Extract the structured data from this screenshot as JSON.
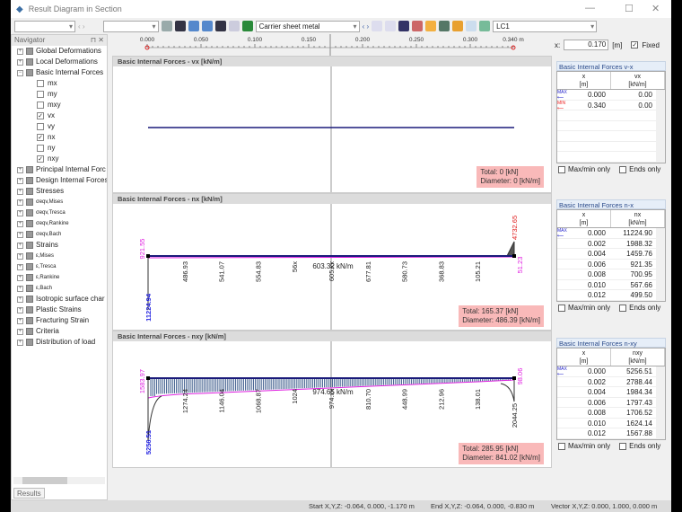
{
  "window": {
    "title": "Result Diagram in Section"
  },
  "toolbar": {
    "member_combo": "Carrier sheet metal",
    "lc_combo": "LC1"
  },
  "navigator": {
    "title": "Navigator",
    "results_tab": "Results",
    "items": [
      {
        "label": "Global Deformations",
        "type": "group"
      },
      {
        "label": "Local Deformations",
        "type": "group"
      },
      {
        "label": "Basic Internal Forces",
        "type": "group-open"
      },
      {
        "label": "mx",
        "type": "check",
        "checked": false
      },
      {
        "label": "my",
        "type": "check",
        "checked": false
      },
      {
        "label": "mxy",
        "type": "check",
        "checked": false
      },
      {
        "label": "vx",
        "type": "check",
        "checked": true
      },
      {
        "label": "vy",
        "type": "check",
        "checked": false
      },
      {
        "label": "nx",
        "type": "check",
        "checked": true
      },
      {
        "label": "ny",
        "type": "check",
        "checked": false
      },
      {
        "label": "nxy",
        "type": "check",
        "checked": true
      },
      {
        "label": "Principal Internal Forc",
        "type": "group"
      },
      {
        "label": "Design Internal Forces",
        "type": "group"
      },
      {
        "label": "Stresses",
        "type": "group"
      },
      {
        "label": "σeqv,Mises",
        "type": "group-small"
      },
      {
        "label": "σeqv,Tresca",
        "type": "group-small"
      },
      {
        "label": "σeqv,Rankine",
        "type": "group-small"
      },
      {
        "label": "σeqv,Bach",
        "type": "group-small"
      },
      {
        "label": "Strains",
        "type": "group"
      },
      {
        "label": "ε,Mises",
        "type": "group-small"
      },
      {
        "label": "ε,Tresca",
        "type": "group-small"
      },
      {
        "label": "ε,Rankine",
        "type": "group-small"
      },
      {
        "label": "ε,Bach",
        "type": "group-small"
      },
      {
        "label": "Isotropic surface char",
        "type": "group"
      },
      {
        "label": "Plastic Strains",
        "type": "group"
      },
      {
        "label": "Fracturing Strain",
        "type": "group"
      },
      {
        "label": "Criteria",
        "type": "group"
      },
      {
        "label": "Distribution of load",
        "type": "group"
      }
    ]
  },
  "ruler": {
    "ticks": [
      "0.000",
      "0.050",
      "0.100",
      "0.150",
      "0.200",
      "0.250",
      "0.300",
      "0.340 m"
    ],
    "x_label": "x:",
    "x_value": "0.170",
    "x_unit": "[m]",
    "fixed_label": "Fixed",
    "fixed_checked": true,
    "section_x": 0.17,
    "length": 0.34
  },
  "diagrams": [
    {
      "title": "Basic Internal Forces - vx [kN/m]",
      "total": "Total: 0 [kN]",
      "diameter": "Diameter: 0 [kN/m]",
      "labels": [],
      "fill": false
    },
    {
      "title": "Basic Internal Forces - nx [kN/m]",
      "total": "Total: 165.37 [kN]",
      "diameter": "Diameter: 486.39 [kN/m]",
      "fill": false,
      "mean": "603.32 kN/m",
      "labels": [
        "486.93",
        "541.07",
        "554.83",
        "56x",
        "605.xx",
        "677.81",
        "580.73",
        "368.83",
        "105.21"
      ],
      "start_labels": {
        "magenta": "921.55",
        "blue": "11224.94"
      },
      "end_labels": {
        "red": "4732.65",
        "magenta": "51.23"
      }
    },
    {
      "title": "Basic Internal Forces - nxy [kN/m]",
      "total": "Total: 285.95 [kN]",
      "diameter": "Diameter: 841.02 [kN/m]",
      "fill": true,
      "mean": "974.65 kN/m",
      "labels": [
        "1274.24",
        "1146.04",
        "1068.87",
        "1024",
        "974.xx",
        "810.70",
        "448.99",
        "212.96",
        "138.01"
      ],
      "start_labels": {
        "magenta": "1583.97",
        "blue": "5256.51"
      },
      "end_labels": {
        "magenta": "98.06",
        "black": "2044.25"
      }
    }
  ],
  "tables": [
    {
      "title": "Basic Internal Forces v-x",
      "col1": "x",
      "col1_unit": "[m]",
      "col2": "vx",
      "col2_unit": "[kN/m]",
      "rows": [
        {
          "tag": "MAX",
          "x": "0.000",
          "v": "0.00"
        },
        {
          "tag": "MIN",
          "x": "0.340",
          "v": "0.00"
        }
      ]
    },
    {
      "title": "Basic Internal Forces n-x",
      "col1": "x",
      "col1_unit": "[m]",
      "col2": "nx",
      "col2_unit": "[kN/m]",
      "rows": [
        {
          "tag": "MAX",
          "x": "0.000",
          "v": "11224.90"
        },
        {
          "x": "0.002",
          "v": "1988.32"
        },
        {
          "x": "0.004",
          "v": "1459.76"
        },
        {
          "x": "0.006",
          "v": "921.35"
        },
        {
          "x": "0.008",
          "v": "700.95"
        },
        {
          "x": "0.010",
          "v": "567.66"
        },
        {
          "x": "0.012",
          "v": "499.50"
        }
      ]
    },
    {
      "title": "Basic Internal Forces n-xy",
      "col1": "x",
      "col1_unit": "[m]",
      "col2": "nxy",
      "col2_unit": "[kN/m]",
      "rows": [
        {
          "tag": "MAX",
          "x": "0.000",
          "v": "5256.51"
        },
        {
          "x": "0.002",
          "v": "2788.44"
        },
        {
          "x": "0.004",
          "v": "1984.34"
        },
        {
          "x": "0.006",
          "v": "1797.43"
        },
        {
          "x": "0.008",
          "v": "1706.52"
        },
        {
          "x": "0.010",
          "v": "1624.14"
        },
        {
          "x": "0.012",
          "v": "1567.88"
        }
      ]
    }
  ],
  "table_options": {
    "maxmin": "Max/min only",
    "ends": "Ends only"
  },
  "status": {
    "start": "Start X,Y,Z:  -0.064, 0.000, -1.170 m",
    "end": "End X,Y,Z:  -0.064, 0.000, -0.830 m",
    "vector": "Vector X,Y,Z:  0.000, 1.000, 0.000 m"
  },
  "colors": {
    "line": "#1a1a7a",
    "magenta": "#e020e0",
    "blue": "#2020e0",
    "red": "#e02020",
    "summary": "#f9b9b9"
  }
}
